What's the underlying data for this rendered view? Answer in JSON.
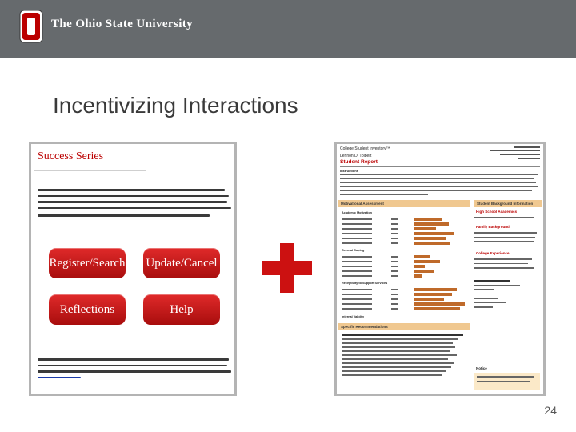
{
  "header": {
    "university_name": "The Ohio State University",
    "logo_icon": "block-o-logo-icon",
    "background_color": "#666a6d"
  },
  "slide": {
    "title": "Incentivizing Interactions",
    "page_number": "24"
  },
  "left_screenshot": {
    "title": "Success Series",
    "buttons": {
      "register_search": "Register/Search",
      "update_cancel": "Update/Cancel",
      "reflections": "Reflections",
      "help": "Help"
    },
    "button_color": "#c01515"
  },
  "plus_icon": {
    "name": "plus-icon",
    "color": "#cc1111"
  },
  "right_screenshot": {
    "title": "College Student Inventory™",
    "student_name": "Lennon D. Tolbert",
    "report_type": "Student Report",
    "sections": {
      "instructions": "Instructions",
      "motivational_assessment": "Motivational Assessment",
      "background_information": "Student Background Information",
      "academic_motivation": "Academic Motivation",
      "general_coping": "General Coping",
      "receptivity": "Receptivity to Support Services",
      "internal_validity": "Internal Validity",
      "specific_recommendations": "Specific Recommendations",
      "high_school_academics": "High School Academics",
      "family_background": "Family Background",
      "college_experience": "College Experience",
      "notice": "Notice"
    },
    "band_color": "#f0c890",
    "bar_color": "#bf6a2a"
  }
}
